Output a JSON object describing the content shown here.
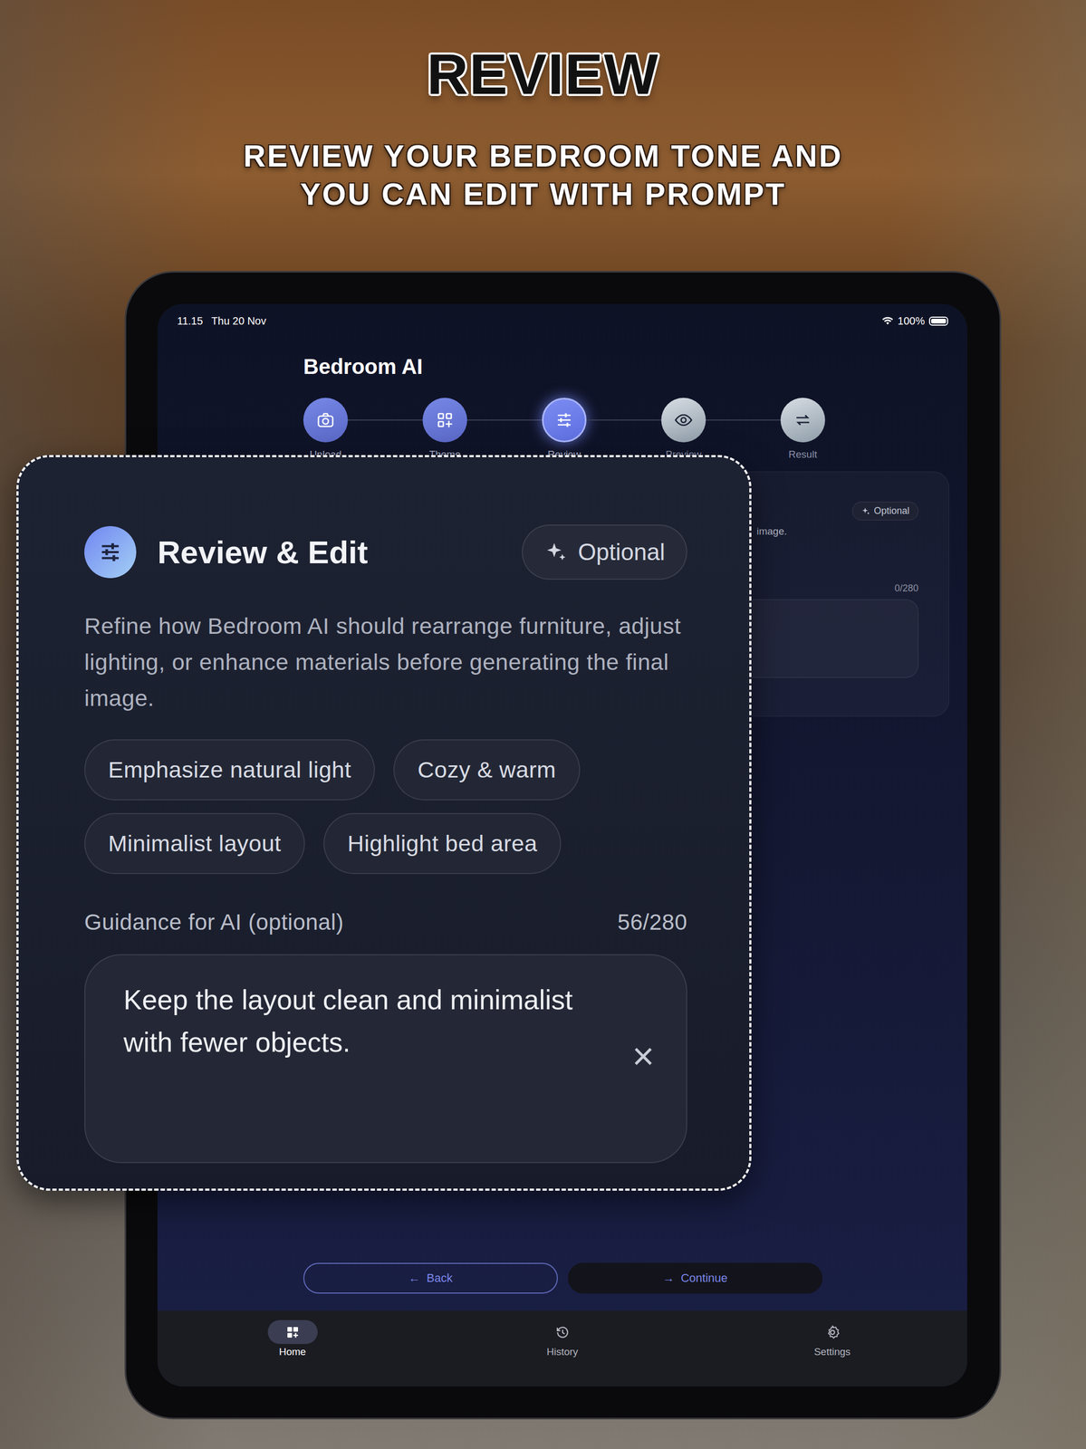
{
  "headline": {
    "title": "REVIEW",
    "subtitle_lines": [
      "REVIEW YOUR BEDROOM TONE AND",
      "YOU CAN EDIT WITH PROMPT"
    ]
  },
  "status_bar": {
    "time": "11.15",
    "date": "Thu 20 Nov",
    "battery": "100%"
  },
  "app": {
    "title": "Bedroom AI"
  },
  "steps": [
    {
      "label": "Upload",
      "done": true,
      "selected": false
    },
    {
      "label": "Theme",
      "done": true,
      "selected": false
    },
    {
      "label": "Review",
      "done": false,
      "selected": true
    },
    {
      "label": "Preview",
      "done": false,
      "selected": false
    },
    {
      "label": "Result",
      "done": false,
      "selected": false
    }
  ],
  "background_card": {
    "badge": "Optional",
    "description": "image.",
    "counter": "0/280"
  },
  "review_card": {
    "title": "Review & Edit",
    "badge": "Optional",
    "description": "Refine how Bedroom AI should rearrange furniture, adjust lighting, or enhance materials before generating the final image.",
    "chips": [
      {
        "label": "Emphasize natural light",
        "selected": false
      },
      {
        "label": "Cozy & warm",
        "selected": false
      },
      {
        "label": "Minimalist layout",
        "selected": false
      },
      {
        "label": "Highlight bed area",
        "selected": false
      }
    ],
    "guidance_label": "Guidance for AI (optional)",
    "counter": "56/280",
    "value": "Keep the layout clean and minimalist with fewer objects.",
    "clear": "×"
  },
  "buttons": [
    {
      "label": "Back",
      "arrow": "←",
      "kind": "outline"
    },
    {
      "label": "Continue",
      "arrow": "→",
      "kind": "filled"
    }
  ],
  "tabs": [
    {
      "label": "Home",
      "selected": true
    },
    {
      "label": "History",
      "selected": false
    },
    {
      "label": "Settings",
      "selected": false
    }
  ]
}
